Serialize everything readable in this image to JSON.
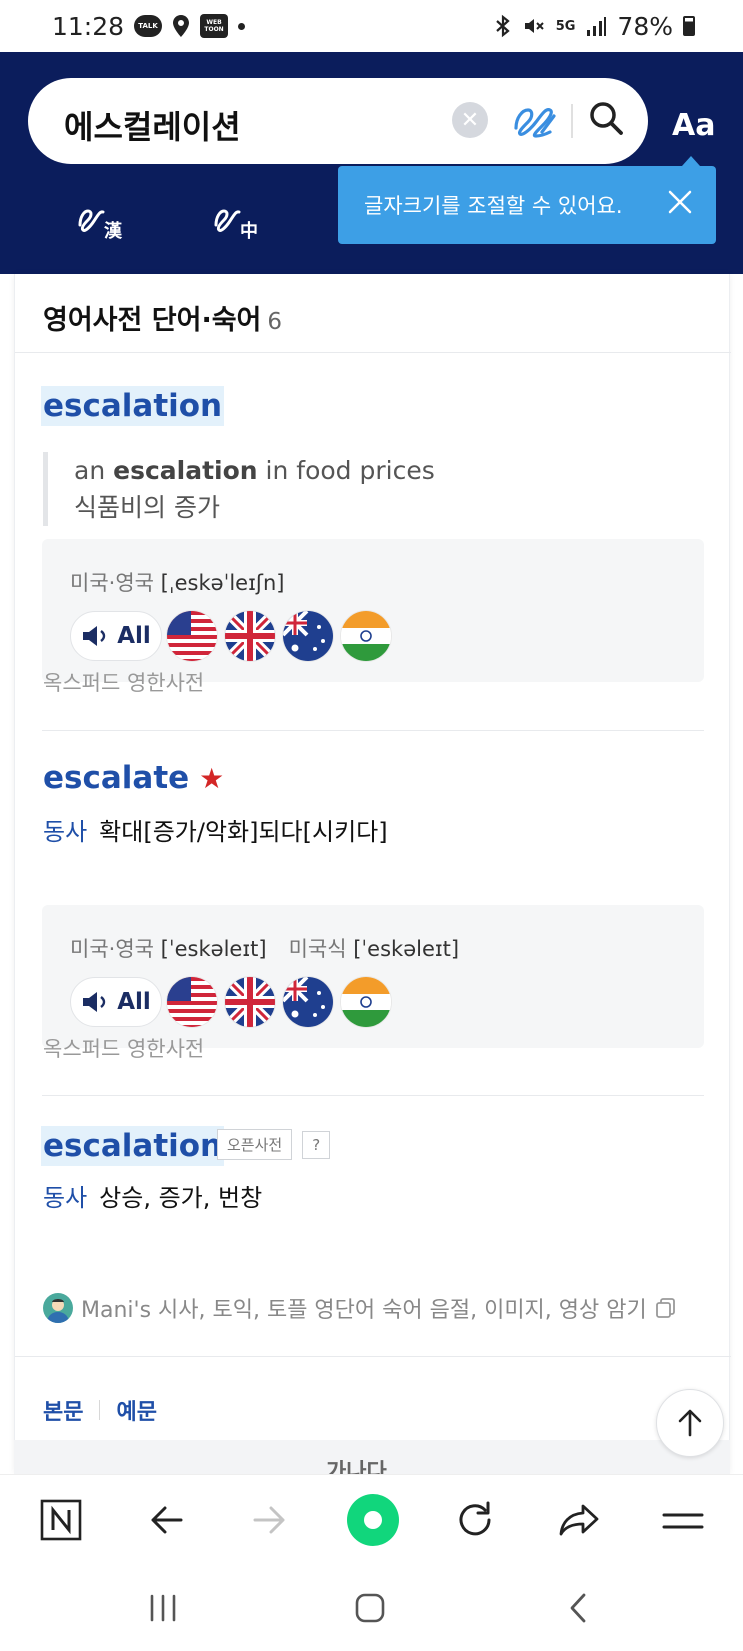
{
  "status_bar": {
    "time": "11:28",
    "talk_label": "TALK",
    "webtoon_label": "WEB TOON",
    "network": "5G",
    "battery": "78%"
  },
  "header": {
    "search_value": "에스컬레이션",
    "font_button_label": "Aa",
    "tooltip_text": "글자크기를 조절할 수 있어요."
  },
  "section": {
    "title": "영어사전 단어·숙어",
    "count": "6"
  },
  "entries": [
    {
      "word": "escalation",
      "example_pre": "an ",
      "example_bold": "escalation",
      "example_post": " in food prices",
      "example_translation": "식품비의 증가",
      "pron_label_1": "미국·영국",
      "pron_1": "[ˌeskəˈleɪʃn]",
      "all_label": "All",
      "source": "옥스퍼드 영한사전"
    },
    {
      "word": "escalate",
      "pos": "동사",
      "meaning": "확대[증가/악화]되다[시키다]",
      "pron_label_1": "미국·영국",
      "pron_1": "[ˈeskəleɪt]",
      "pron_label_2": "미국식",
      "pron_2": "[ˈeskəleɪt]",
      "all_label": "All",
      "source": "옥스퍼드 영한사전"
    },
    {
      "word": "escalation",
      "tag": "오픈사전",
      "help": "?",
      "pos": "동사",
      "meaning": "상승, 증가, 번창",
      "author": "Mani's 시사, 토익, 토플 영단어 숙어 음절, 이미지, 영상 암기"
    }
  ],
  "tabs": [
    "본문",
    "예문"
  ],
  "footer_partial": "가나다"
}
